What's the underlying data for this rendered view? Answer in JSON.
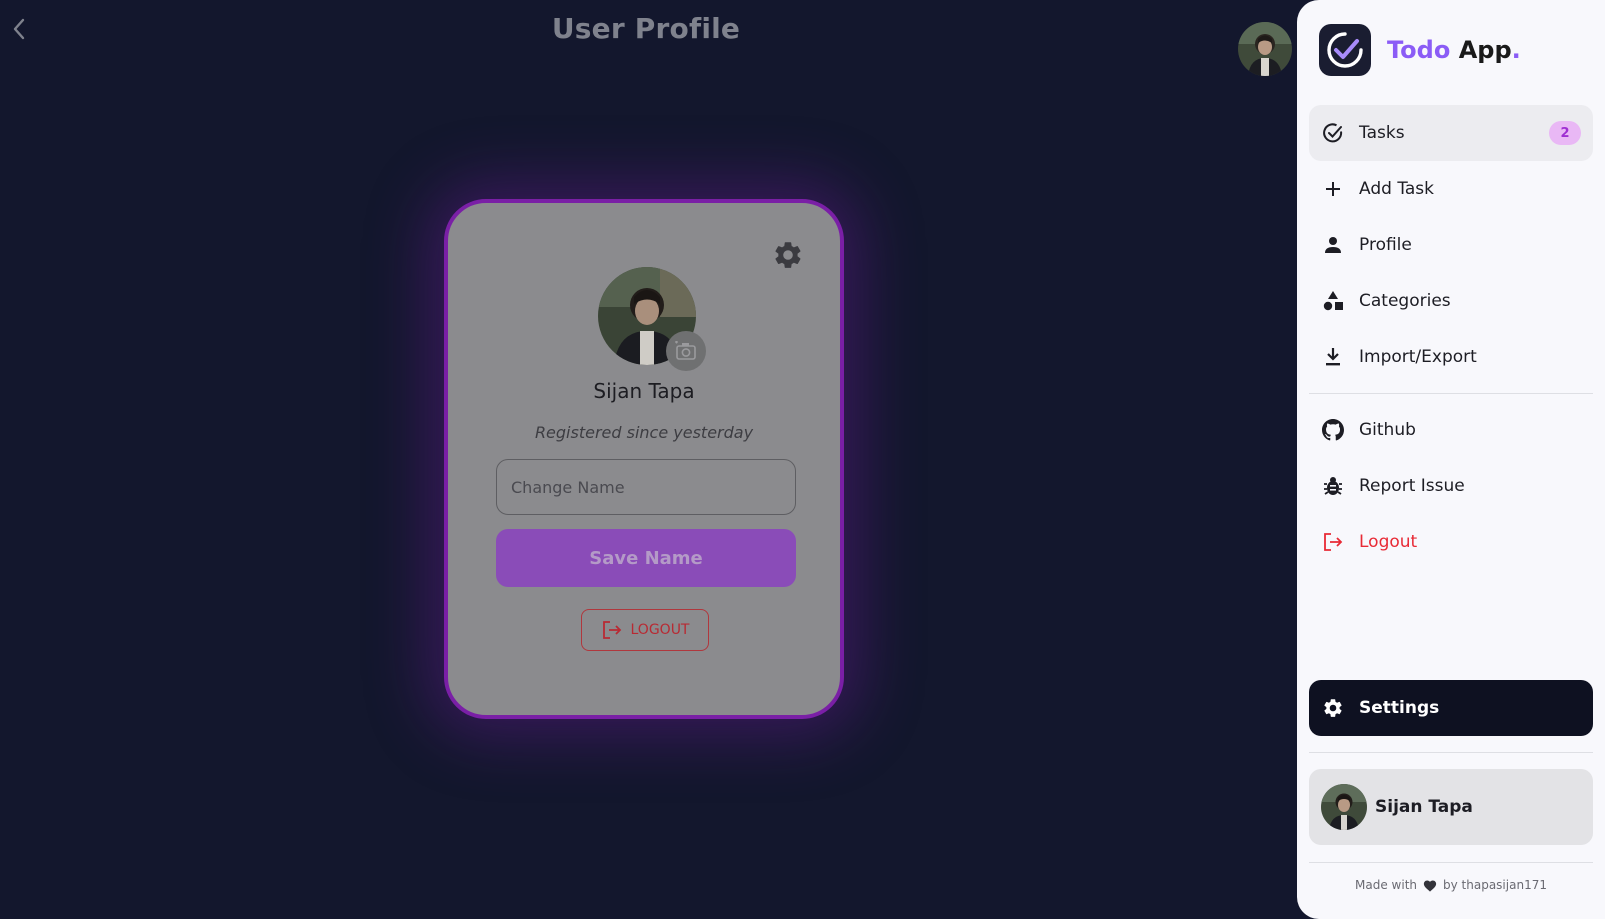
{
  "header": {
    "title": "User Profile",
    "back_icon": "chevron-left-icon"
  },
  "profile_card": {
    "name": "Sijan Tapa",
    "registered_text": "Registered since yesterday",
    "name_input_placeholder": "Change Name",
    "name_input_value": "",
    "save_label": "Save Name",
    "logout_label": "LOGOUT"
  },
  "sidebar": {
    "brand": {
      "name_part1": "Todo",
      "name_part2": " App",
      "dot": "."
    },
    "nav_items": [
      {
        "label": "Tasks",
        "icon": "check-circle-icon",
        "badge": "2",
        "active": true
      },
      {
        "label": "Add Task",
        "icon": "plus-icon"
      },
      {
        "label": "Profile",
        "icon": "person-icon"
      },
      {
        "label": "Categories",
        "icon": "category-icon"
      },
      {
        "label": "Import/Export",
        "icon": "download-icon"
      }
    ],
    "secondary_items": [
      {
        "label": "Github",
        "icon": "github-icon"
      },
      {
        "label": "Report Issue",
        "icon": "bug-icon"
      },
      {
        "label": "Logout",
        "icon": "logout-icon"
      }
    ],
    "settings_label": "Settings",
    "user_name": "Sijan Tapa",
    "footer": {
      "made_with": "Made with",
      "by": "by thapasijan171"
    }
  },
  "colors": {
    "background": "#13172d",
    "accent": "#8b5cf6",
    "card_border": "#7a1fa6",
    "danger": "#e82a35"
  }
}
